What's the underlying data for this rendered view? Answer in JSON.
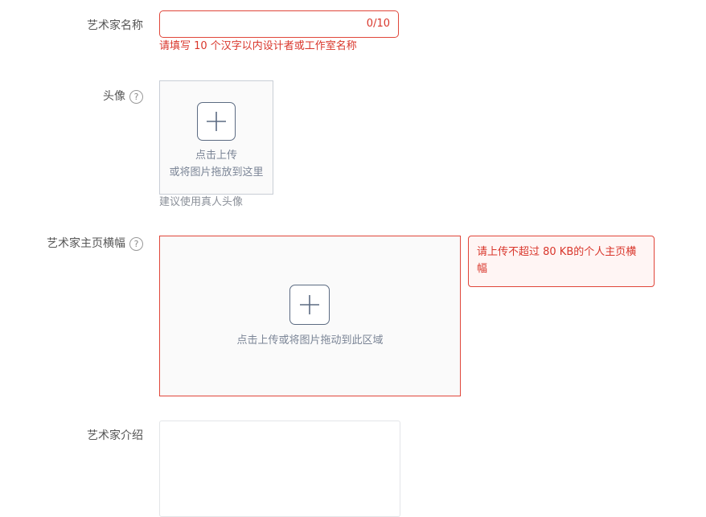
{
  "form": {
    "name": {
      "label": "艺术家名称",
      "value": "",
      "counter": "0/10",
      "error": "请填写 10 个汉字以内设计者或工作室名称"
    },
    "avatar": {
      "label": "头像",
      "help_glyph": "?",
      "upload_line1": "点击上传",
      "upload_line2": "或将图片拖放到这里",
      "hint": "建议使用真人头像"
    },
    "banner": {
      "label": "艺术家主页横幅",
      "help_glyph": "?",
      "upload_text": "点击上传或将图片拖动到此区域",
      "error_tip": "请上传不超过 80 KB的个人主页横幅"
    },
    "intro": {
      "label": "艺术家介绍",
      "value": ""
    }
  },
  "icons": {
    "help": "question-circle-icon",
    "upload": "plus-icon"
  },
  "colors": {
    "error": "#d9362b",
    "error_border": "#e0463a",
    "error_bg": "#fff5f4",
    "upload_border": "#c9ced6",
    "upload_bg": "#fafafa",
    "muted_text": "#7b8596",
    "label_text": "#555555"
  }
}
